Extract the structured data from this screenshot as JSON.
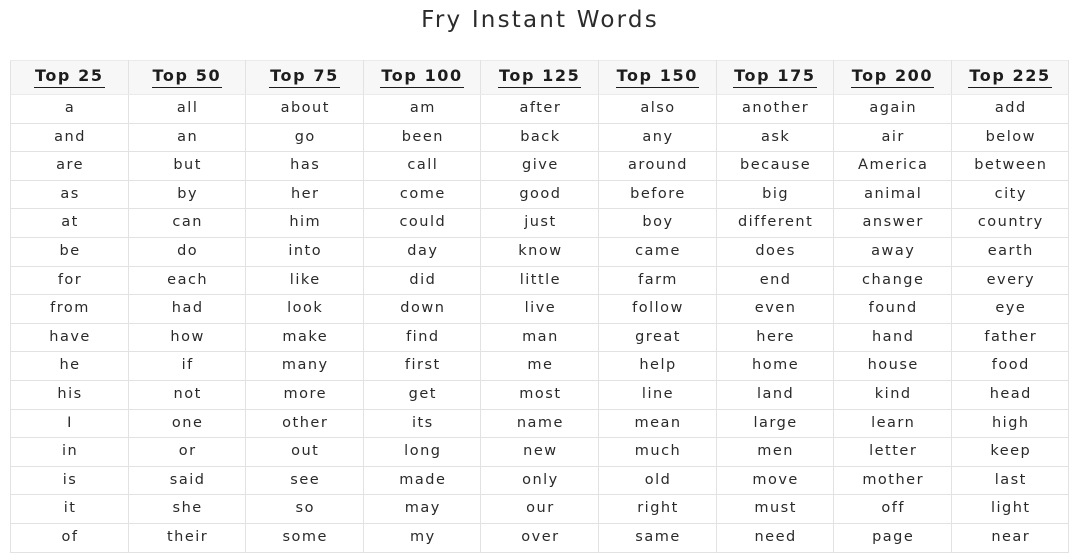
{
  "page": {
    "title": "Fry Instant Words",
    "background_color": "#ffffff",
    "text_color": "#2a2a2a",
    "border_color": "#e2e2e2",
    "header_background_color": "#f7f7f7"
  },
  "table": {
    "headers": [
      "Top 25",
      "Top 50",
      "Top 75",
      "Top 100",
      "Top 125",
      "Top 150",
      "Top 175",
      "Top 200",
      "Top 225"
    ],
    "rows": [
      [
        "a",
        "all",
        "about",
        "am",
        "after",
        "also",
        "another",
        "again",
        "add"
      ],
      [
        "and",
        "an",
        "go",
        "been",
        "back",
        "any",
        "ask",
        "air",
        "below"
      ],
      [
        "are",
        "but",
        "has",
        "call",
        "give",
        "around",
        "because",
        "America",
        "between"
      ],
      [
        "as",
        "by",
        "her",
        "come",
        "good",
        "before",
        "big",
        "animal",
        "city"
      ],
      [
        "at",
        "can",
        "him",
        "could",
        "just",
        "boy",
        "different",
        "answer",
        "country"
      ],
      [
        "be",
        "do",
        "into",
        "day",
        "know",
        "came",
        "does",
        "away",
        "earth"
      ],
      [
        "for",
        "each",
        "like",
        "did",
        "little",
        "farm",
        "end",
        "change",
        "every"
      ],
      [
        "from",
        "had",
        "look",
        "down",
        "live",
        "follow",
        "even",
        "found",
        "eye"
      ],
      [
        "have",
        "how",
        "make",
        "find",
        "man",
        "great",
        "here",
        "hand",
        "father"
      ],
      [
        "he",
        "if",
        "many",
        "first",
        "me",
        "help",
        "home",
        "house",
        "food"
      ],
      [
        "his",
        "not",
        "more",
        "get",
        "most",
        "line",
        "land",
        "kind",
        "head"
      ],
      [
        "I",
        "one",
        "other",
        "its",
        "name",
        "mean",
        "large",
        "learn",
        "high"
      ],
      [
        "in",
        "or",
        "out",
        "long",
        "new",
        "much",
        "men",
        "letter",
        "keep"
      ],
      [
        "is",
        "said",
        "see",
        "made",
        "only",
        "old",
        "move",
        "mother",
        "last"
      ],
      [
        "it",
        "she",
        "so",
        "may",
        "our",
        "right",
        "must",
        "off",
        "light"
      ],
      [
        "of",
        "their",
        "some",
        "my",
        "over",
        "same",
        "need",
        "page",
        "near"
      ]
    ]
  }
}
